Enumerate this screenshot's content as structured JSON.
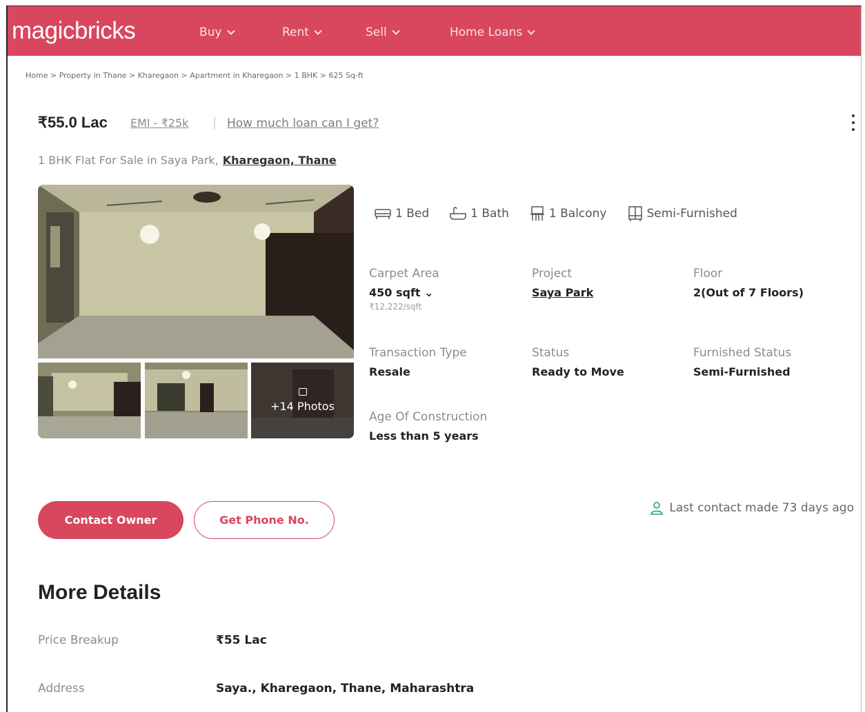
{
  "brand": {
    "logo": "magicbricks",
    "color": "#d8475e"
  },
  "nav": {
    "items": [
      "Buy",
      "Rent",
      "Sell",
      "Home Loans"
    ]
  },
  "breadcrumb": "Home > Property in Thane > Kharegaon > Apartment in Kharegaon > 1 BHK > 625 Sq-ft",
  "listing": {
    "price": "₹55.0 Lac",
    "emi": "EMI - ₹25k",
    "separator": "|",
    "loan_link": "How much loan can I get?",
    "title_prefix": "1 BHK Flat For Sale in Saya Park,",
    "title_location": "Kharegaon, Thane",
    "photos_label": "+14 Photos"
  },
  "features": [
    {
      "icon": "bed-icon",
      "label": "1 Bed"
    },
    {
      "icon": "bath-icon",
      "label": "1 Bath"
    },
    {
      "icon": "balcony-icon",
      "label": "1 Balcony"
    },
    {
      "icon": "furnished-icon",
      "label": "Semi-Furnished"
    }
  ],
  "facts": {
    "carpet_area": {
      "label": "Carpet Area",
      "value": "450 sqft",
      "sub": "₹12,222/sqft"
    },
    "project": {
      "label": "Project",
      "value": "Saya Park"
    },
    "floor": {
      "label": "Floor",
      "value": "2(Out of 7 Floors)"
    },
    "transaction": {
      "label": "Transaction Type",
      "value": "Resale"
    },
    "status": {
      "label": "Status",
      "value": "Ready to Move"
    },
    "furnished": {
      "label": "Furnished Status",
      "value": "Semi-Furnished"
    },
    "age": {
      "label": "Age Of Construction",
      "value": "Less than 5 years"
    }
  },
  "actions": {
    "contact_owner": "Contact Owner",
    "get_phone": "Get Phone No.",
    "last_contact": "Last contact made 73 days ago"
  },
  "more_details": {
    "heading": "More Details",
    "rows": [
      {
        "label": "Price Breakup",
        "value": "₹55 Lac"
      },
      {
        "label": "Address",
        "value": "Saya., Kharegaon, Thane, Maharashtra"
      }
    ]
  }
}
